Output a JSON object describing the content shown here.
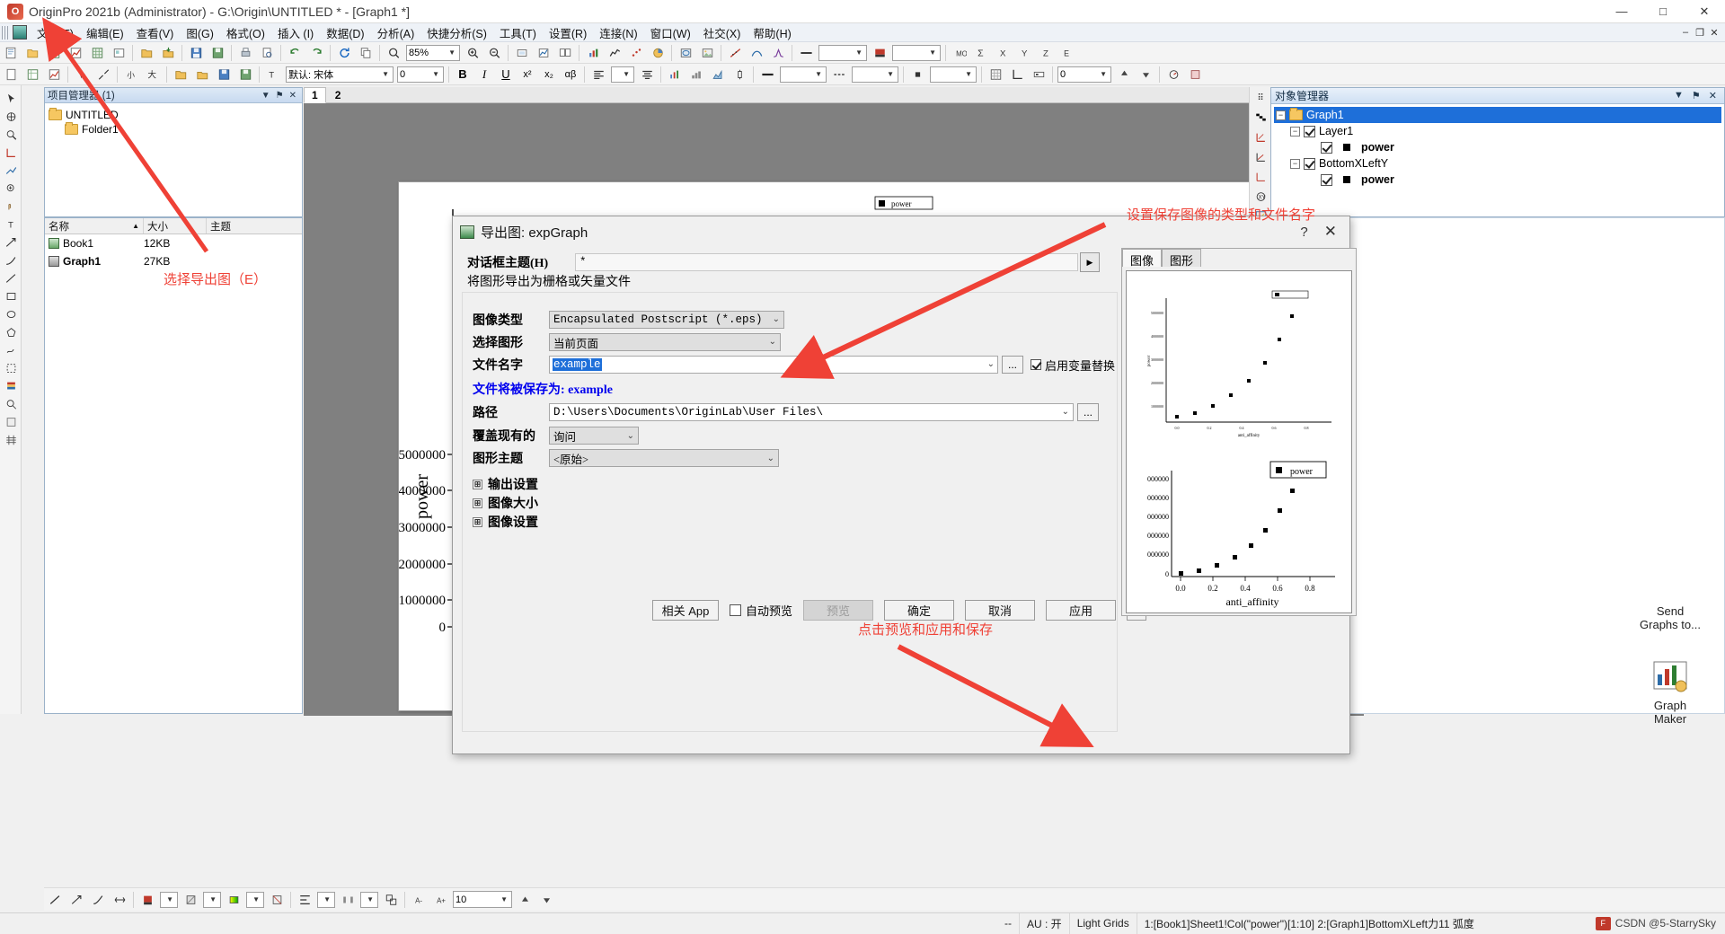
{
  "titlebar": {
    "title": "OriginPro 2021b (Administrator) - G:\\Origin\\UNTITLED * - [Graph1 *]",
    "minimize": "—",
    "maximize": "□",
    "close": "✕"
  },
  "menubar": {
    "items": [
      {
        "label": "文件(F)"
      },
      {
        "label": "编辑(E)"
      },
      {
        "label": "查看(V)"
      },
      {
        "label": "图(G)"
      },
      {
        "label": "格式(O)"
      },
      {
        "label": "插入 (I)"
      },
      {
        "label": "数据(D)"
      },
      {
        "label": "分析(A)"
      },
      {
        "label": "快捷分析(S)"
      },
      {
        "label": "工具(T)"
      },
      {
        "label": "设置(R)"
      },
      {
        "label": "连接(N)"
      },
      {
        "label": "窗口(W)"
      },
      {
        "label": "社交(X)"
      },
      {
        "label": "帮助(H)"
      }
    ],
    "mdi_minimize": "–",
    "mdi_restore": "❐",
    "mdi_close": "✕"
  },
  "toolbar1": {
    "zoom_value": "85%",
    "icons": [
      "new-project-icon",
      "new-folder-icon",
      "new-workbook-icon",
      "new-graph-icon",
      "open-icon",
      "import-icon",
      "save-icon",
      "save-template-icon",
      "print-icon",
      "print-preview-icon",
      "undo-icon",
      "redo-icon",
      "refresh-icon",
      "duplicate-icon",
      "rescale-icon",
      "zoom-in-icon",
      "zoom-out-icon",
      "pan-icon"
    ]
  },
  "toolbar2": {
    "font_name": "默认: 宋体",
    "font_size": "0",
    "bold": "B",
    "italic": "I",
    "underline": "U",
    "superscript": "x²",
    "subscript": "x₂",
    "greek": "αβ",
    "value2": "0",
    "value3": "0"
  },
  "project_manager": {
    "title": "项目管理器 (1)",
    "root": "UNTITLED",
    "child": "Folder1",
    "dropdown_icon": "▼",
    "pin_icon": "⚑",
    "close_icon": "✕"
  },
  "file_list": {
    "columns": [
      "名称",
      "大小",
      "主题"
    ],
    "sort_icon": "▲",
    "rows": [
      {
        "name": "Book1",
        "size": "12KB",
        "theme": ""
      },
      {
        "name": "Graph1",
        "size": "27KB",
        "theme": ""
      }
    ]
  },
  "workspace_tabs": {
    "tabs": [
      {
        "label": "1",
        "active": true
      },
      {
        "label": "2",
        "active": false
      }
    ]
  },
  "graph": {
    "legend_label": "power",
    "xlabel": "anti_affinity",
    "ylabel": "power"
  },
  "chart_data": {
    "type": "scatter",
    "title": "",
    "xlabel": "anti_affinity",
    "ylabel": "power",
    "xticks": [
      "0.0",
      "0.2",
      "0.4",
      "0.6",
      "0.8"
    ],
    "yticks": [
      "0",
      "1000000",
      "2000000",
      "3000000",
      "4000000",
      "5000000"
    ],
    "xlim": [
      -0.05,
      0.92
    ],
    "ylim": [
      -200000,
      5400000
    ],
    "legend": [
      "power"
    ],
    "grid": false,
    "series": [
      {
        "name": "power",
        "marker": "square",
        "color": "#000000",
        "points": [
          {
            "x": 0.03,
            "y": 100000
          },
          {
            "x": 0.1,
            "y": 180000
          },
          {
            "x": 0.22,
            "y": 400000
          },
          {
            "x": 0.36,
            "y": 720000
          },
          {
            "x": 0.46,
            "y": 1250000
          },
          {
            "x": 0.55,
            "y": 1900000
          },
          {
            "x": 0.64,
            "y": 2700000
          },
          {
            "x": 0.72,
            "y": 3700000
          },
          {
            "x": 0.79,
            "y": 4800000
          }
        ]
      }
    ]
  },
  "dialog": {
    "icon": "export-graph-icon",
    "title": "导出图: expGraph",
    "help_icon": "?",
    "close_icon": "✕",
    "theme_label": "对话框主题(H)",
    "theme_value": "*",
    "theme_play_icon": "▶",
    "description": "将图形导出为栅格或矢量文件",
    "fields": {
      "image_type_label": "图像类型",
      "image_type_value": "Encapsulated Postscript (*.eps)",
      "select_graph_label": "选择图形",
      "select_graph_value": "当前页面",
      "file_name_label": "文件名字",
      "file_name_value": "example",
      "browse_button": "...",
      "var_sub_label": "启用变量替换",
      "save_as_note": "文件将被保存为: example",
      "path_label": "路径",
      "path_value": "D:\\Users\\Documents\\OriginLab\\User Files\\",
      "path_browse": "...",
      "overwrite_label": "覆盖现有的",
      "overwrite_value": "询问",
      "graph_theme_label": "图形主题",
      "graph_theme_value": "<原始>"
    },
    "sections": [
      {
        "label": "输出设置",
        "expander": "⊞"
      },
      {
        "label": "图像大小",
        "expander": "⊞"
      },
      {
        "label": "图像设置",
        "expander": "⊞"
      }
    ],
    "buttons": {
      "related_app": "相关 App",
      "auto_preview": "自动预览",
      "preview": "预览",
      "ok": "确定",
      "cancel": "取消",
      "apply": "应用",
      "collapse": "≪"
    },
    "preview": {
      "tabs": [
        {
          "label": "图像",
          "active": true
        },
        {
          "label": "图形",
          "active": false
        }
      ],
      "legend_label": "power",
      "xlabel": "anti_affinity",
      "xticks": [
        "0.0",
        "0.2",
        "0.4",
        "0.6",
        "0.8"
      ],
      "yticks": [
        "0",
        "000000",
        "000000",
        "000000",
        "000000",
        "000000"
      ]
    }
  },
  "object_manager": {
    "title": "对象管理器",
    "dropdown_icon": "▼",
    "pin_icon": "⚑",
    "close_icon": "✕",
    "nodes": [
      {
        "label": "Graph1",
        "level": 0,
        "selected": true,
        "expander": "−",
        "has_checkbox": false,
        "icon": "folder-icon"
      },
      {
        "label": "Layer1",
        "level": 1,
        "selected": false,
        "expander": "−",
        "has_checkbox": true,
        "icon": ""
      },
      {
        "label": "power",
        "level": 2,
        "selected": false,
        "expander": "",
        "has_checkbox": true,
        "icon": "square-marker"
      },
      {
        "label": "BottomXLeftY",
        "level": 1,
        "selected": false,
        "expander": "−",
        "has_checkbox": true,
        "icon": ""
      },
      {
        "label": "power",
        "level": 2,
        "selected": false,
        "expander": "",
        "has_checkbox": true,
        "icon": "square-marker"
      }
    ]
  },
  "apps_panel": {
    "send_graphs_label": "Send\nGraphs to...",
    "graph_maker_label": "Graph\nMaker"
  },
  "annotations": [
    {
      "id": "anno-export",
      "text": "选择导出图（E）",
      "color": "#ef4136"
    },
    {
      "id": "anno-settype",
      "text": "设置保存图像的类型和文件名字",
      "color": "#ef4136"
    },
    {
      "id": "anno-preview",
      "text": "点击预览和应用和保存",
      "color": "#ef4136"
    }
  ],
  "statusbar": {
    "left": "--",
    "segments": [
      "AU : 开",
      "Light Grids",
      "1:[Book1]Sheet1!Col(\"power\")[1:10]  2:[Graph1]BottomXLeft力11  弧度"
    ],
    "watermark": "CSDN @5-StarrySky"
  },
  "bottom_toolbar": {
    "size_value": "10",
    "spin_value": ""
  },
  "colors": {
    "accent_red": "#ef4136",
    "select_blue": "#1e6fd9",
    "link_blue": "#0000ee",
    "dialog_bg": "#f0f0f0"
  }
}
